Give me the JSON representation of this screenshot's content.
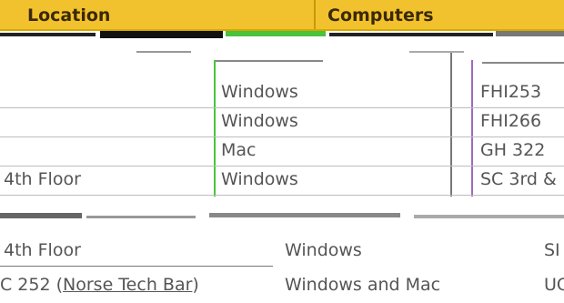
{
  "table": {
    "header": {
      "col_location": "Location",
      "col_computers": "Computers"
    },
    "overlay_rows": [
      {
        "c1": "",
        "c2": "Windows",
        "c3": "FHI253"
      },
      {
        "c1": "",
        "c2": "Windows",
        "c3": "FHI266"
      },
      {
        "c1": "",
        "c2": "Mac",
        "c3": "GH 322"
      },
      {
        "c1": "4th Floor",
        "c2": "Windows",
        "c3": "SC 3rd &"
      }
    ],
    "lower_rows": [
      {
        "c1": "4th Floor",
        "c2": "Windows",
        "c3": "SI"
      },
      {
        "c1_prefix": "C 252 (",
        "c1_link": "Norse Tech Bar",
        "c1_suffix": ")",
        "c2": "Windows and Mac",
        "c3": "UC"
      }
    ]
  },
  "colors": {
    "header_gold": "#f2c12e",
    "accent_green": "#49c23c",
    "accent_purple": "#9b6bbf"
  }
}
